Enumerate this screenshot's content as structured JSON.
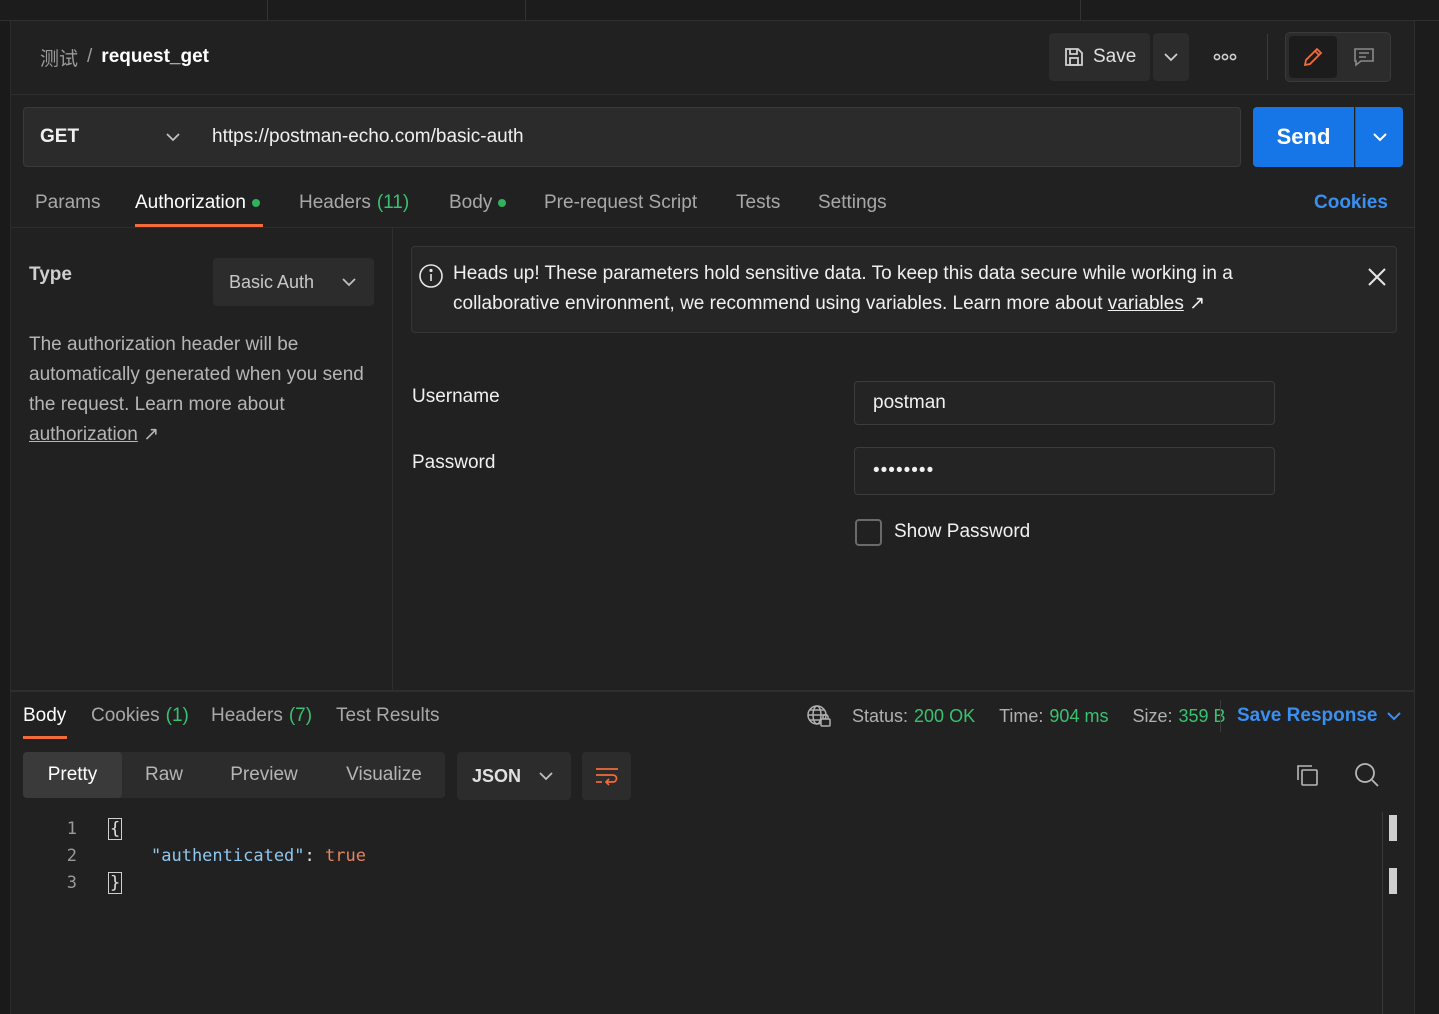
{
  "breadcrumb": {
    "parent": "测试",
    "separator": "/",
    "current": "request_get"
  },
  "toolbar": {
    "save_label": "Save"
  },
  "request": {
    "method": "GET",
    "url": "https://postman-echo.com/basic-auth",
    "send_label": "Send"
  },
  "request_tabs": [
    {
      "label": "Params"
    },
    {
      "label": "Authorization"
    },
    {
      "label": "Headers",
      "count": "(11)"
    },
    {
      "label": "Body"
    },
    {
      "label": "Pre-request Script"
    },
    {
      "label": "Tests"
    },
    {
      "label": "Settings"
    }
  ],
  "cookies_label": "Cookies",
  "auth": {
    "type_label": "Type",
    "type_value": "Basic Auth",
    "description": "The authorization header will be automatically generated when you send the request. Learn more about ",
    "description_link": "authorization",
    "banner_text": "Heads up! These parameters hold sensitive data. To keep this data secure while working in a collaborative environment, we recommend using variables. Learn more about ",
    "banner_link": "variables",
    "username_label": "Username",
    "username_value": "postman",
    "password_label": "Password",
    "password_value": "••••••••",
    "show_password_label": "Show Password"
  },
  "response_tabs": [
    {
      "label": "Body"
    },
    {
      "label": "Cookies",
      "count": "(1)"
    },
    {
      "label": "Headers",
      "count": "(7)"
    },
    {
      "label": "Test Results"
    }
  ],
  "response_status": {
    "status_label": "Status:",
    "status_value": "200 OK",
    "time_label": "Time:",
    "time_value": "904 ms",
    "size_label": "Size:",
    "size_value": "359 B"
  },
  "save_response_label": "Save Response",
  "view_modes": [
    "Pretty",
    "Raw",
    "Preview",
    "Visualize"
  ],
  "format": "JSON",
  "code": {
    "line_numbers": [
      "1",
      "2",
      "3"
    ],
    "open_brace": "{",
    "key": "\"authenticated\"",
    "colon": ": ",
    "value": "true",
    "close_brace": "}"
  },
  "colors": {
    "accent_orange": "#f26b3a",
    "send_blue": "#1676e8",
    "link_blue": "#3b8ff0",
    "status_green": "#3ac16f"
  }
}
